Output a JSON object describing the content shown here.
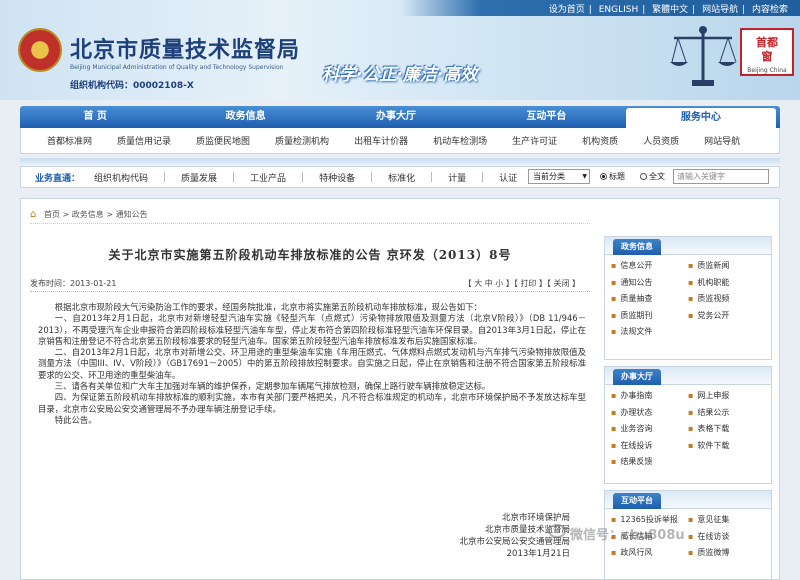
{
  "top_links": [
    "设为首页",
    "ENGLISH",
    "繁體中文",
    "网站导航",
    "内容检索"
  ],
  "org": {
    "name": "北京市质量技术监督局",
    "name_en": "Beijing Municipal Administration of Quality and Technology Supervision",
    "code": "组织机构代码：00002108-X",
    "slogan": "科学·公正·廉洁·高效",
    "logo_text": "首都",
    "logo_text2": "窗",
    "logo_sub": "Beijing China"
  },
  "main_nav": [
    "首  页",
    "政务信息",
    "办事大厅",
    "互动平台",
    "服务中心"
  ],
  "sub_nav": [
    "首都标准网",
    "质量信用记录",
    "质监便民地图",
    "质量检测机构",
    "出租车计价器",
    "机动车检测场",
    "生产许可证",
    "机构资质",
    "人员资质",
    "网站导航"
  ],
  "quick_bar": {
    "label": "业务直通：",
    "links": [
      "组织机构代码",
      "质量发展",
      "工业产品",
      "特种设备",
      "标准化",
      "计量",
      "认证"
    ]
  },
  "search": {
    "select_value": "当前分类",
    "radio_title": "标题",
    "radio_full": "全文",
    "placeholder": "请输入关键字"
  },
  "breadcrumb": "首页 > 政务信息 > 通知公告",
  "article": {
    "title": "关于北京市实施第五阶段机动车排放标准的公告  京环发（2013）8号",
    "date": "发布时间：2013-01-21",
    "font_size_ctrl": "【 大  中  小 】【 打印 】【 关闭 】",
    "paragraphs": [
      "根据北京市现阶段大气污染防治工作的要求，经国务院批准，北京市将实施第五阶段机动车排放标准，现公告如下：",
      "一、自2013年2月1日起，北京市对新增轻型汽油车实施《轻型汽车（点燃式）污染物排放限值及测量方法（北京V阶段）》（DB 11/946－2013），不再受理汽车企业申报符合第四阶段标准轻型汽油车车型，停止发布符合第四阶段标准轻型汽油车环保目录。自2013年3月1日起，停止在京销售和注册登记不符合北京第五阶段标准要求的轻型汽油车。国家第五阶段轻型汽油车排放标准发布后实施国家标准。",
      "二、自2013年2月1日起，北京市对新增公交、环卫用途的重型柴油车实施《车用压燃式、气体燃料点燃式发动机与汽车排气污染物排放限值及测量方法（中国III、IV、V阶段）》（GB17691－2005）中的第五阶段排放控制要求。自实施之日起，停止在京销售和注册不符合国家第五阶段标准要求的公交、环卫用途的重型柴油车。",
      "三、请各有关单位和广大车主加强对车辆的维护保养，定期参加车辆尾气排放检测，确保上路行驶车辆排放稳定达标。",
      "四、为保证第五阶段机动车排放标准的顺利实施，本市有关部门要严格把关，凡不符合标准规定的机动车，北京市环境保护局不予发放达标车型目录，北京市公安局公安交通管理局不予办理车辆注册登记手续。",
      "特此公告。"
    ],
    "signers": [
      "北京市环境保护局",
      "北京市质量技术监督局",
      "北京市公安局公安交通管理局",
      "2013年1月21日"
    ]
  },
  "sidebar": {
    "gov_info": {
      "title": "政务信息",
      "items": [
        "信息公开",
        "质监新闻",
        "通知公告",
        "机构职能",
        "质量抽查",
        "质监视频",
        "质监期刊",
        "党务公开",
        "法规文件"
      ]
    },
    "service_hall": {
      "title": "办事大厅",
      "items": [
        "办事指南",
        "网上申报",
        "办理状态",
        "结果公示",
        "业务咨询",
        "表格下载",
        "在线投诉",
        "软件下载",
        "结果反馈"
      ]
    },
    "interaction": {
      "title": "互动平台",
      "items": [
        "12365投诉举报",
        "意见征集",
        "局长信箱",
        "在线访谈",
        "政风行风",
        "质监微博"
      ]
    }
  },
  "watermark": "微信号：cbu808u"
}
